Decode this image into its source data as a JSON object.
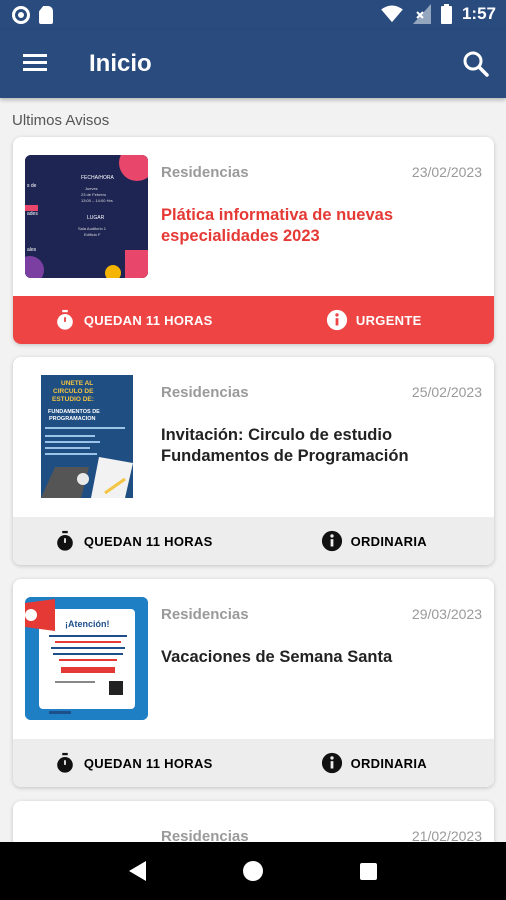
{
  "status_bar": {
    "time": "1:57"
  },
  "app_bar": {
    "title": "Inicio"
  },
  "section": {
    "title": "Ultimos Avisos"
  },
  "cards": [
    {
      "category": "Residencias",
      "date": "23/02/2023",
      "title": "Plática informativa de nuevas especialidades 2023",
      "time_left": "QUEDAN 11 HORAS",
      "priority": "URGENTE",
      "urgent": true,
      "thumb_text": [
        "FECHA/HORA",
        "LUGAR",
        "Sala Auditorio"
      ]
    },
    {
      "category": "Residencias",
      "date": "25/02/2023",
      "title": "Invitación: Circulo de estudio Fundamentos de Programación",
      "time_left": "QUEDAN 11 HORAS",
      "priority": "ORDINARIA",
      "urgent": false,
      "thumb_text": [
        "UNETE AL CIRCULO DE ESTUDIO DE:",
        "FUNDAMENTOS DE PROGRAMACION"
      ]
    },
    {
      "category": "Residencias",
      "date": "29/03/2023",
      "title": "Vacaciones de Semana Santa",
      "time_left": "QUEDAN 11 HORAS",
      "priority": "ORDINARIA",
      "urgent": false,
      "thumb_text": [
        "¡Atención!"
      ]
    },
    {
      "category": "Residencias",
      "date": "21/02/2023"
    }
  ],
  "colors": {
    "primary": "#294b7d",
    "urgent": "#ef4444",
    "urgent_text": "#e53935"
  }
}
